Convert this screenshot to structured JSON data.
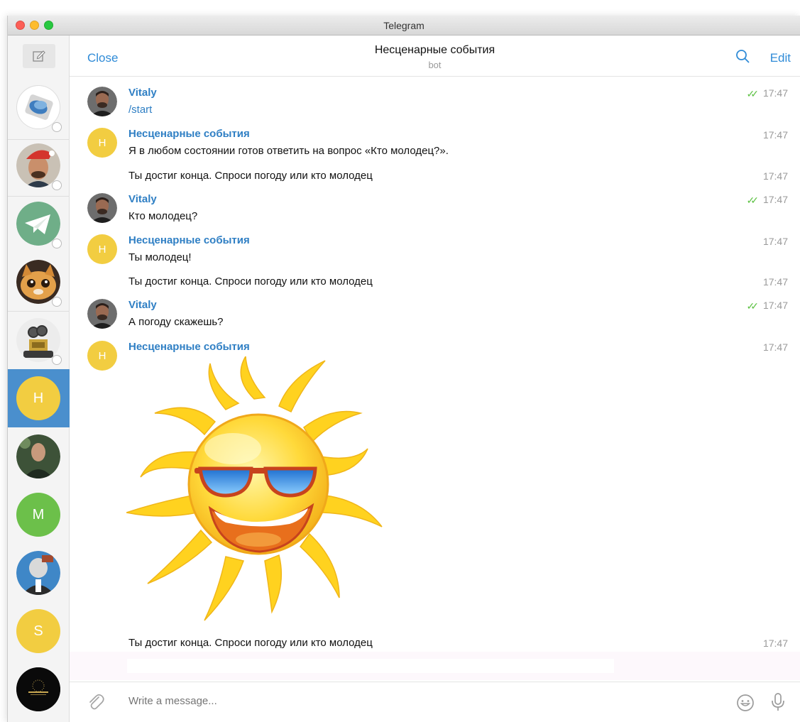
{
  "window": {
    "title": "Telegram"
  },
  "sidebar": {
    "chats": [
      {
        "name": "chat-1",
        "letter": ""
      },
      {
        "name": "chat-2",
        "letter": ""
      },
      {
        "name": "chat-telegram",
        "letter": ""
      },
      {
        "name": "chat-cat",
        "letter": ""
      },
      {
        "name": "chat-robot",
        "letter": ""
      },
      {
        "name": "chat-active",
        "letter": "Н"
      },
      {
        "name": "chat-7",
        "letter": ""
      },
      {
        "name": "chat-m",
        "letter": "M"
      },
      {
        "name": "chat-9",
        "letter": ""
      },
      {
        "name": "chat-s",
        "letter": "S"
      },
      {
        "name": "chat-11",
        "letter": ""
      }
    ]
  },
  "header": {
    "close_label": "Close",
    "title": "Несценарные события",
    "subtitle": "bot",
    "edit_label": "Edit"
  },
  "messages": [
    {
      "sender": "Vitaly",
      "text": "/start",
      "time": "17:47",
      "read": true
    },
    {
      "sender": "Несценарные события",
      "avatar_letter": "Н",
      "text": "Я в любом состоянии готов ответить на вопрос «Кто молодец?».",
      "time": "17:47"
    },
    {
      "text": "Ты достиг конца. Спроси погоду или кто молодец",
      "time": "17:47"
    },
    {
      "sender": "Vitaly",
      "text": "Кто молодец?",
      "time": "17:47",
      "read": true
    },
    {
      "sender": "Несценарные события",
      "avatar_letter": "Н",
      "text": "Ты молодец!",
      "time": "17:47"
    },
    {
      "text": "Ты достиг конца. Спроси погоду или кто молодец",
      "time": "17:47"
    },
    {
      "sender": "Vitaly",
      "text": "А погоду скажешь?",
      "time": "17:47",
      "read": true
    },
    {
      "sender": "Несценарные события",
      "avatar_letter": "Н",
      "time": "17:47"
    },
    {
      "text": "Ты достиг конца. Спроси погоду или кто молодец",
      "time": "17:47"
    }
  ],
  "composer": {
    "placeholder": "Write a message..."
  },
  "colors": {
    "accent": "#2f8bd7",
    "active_chat": "#4a8fcd",
    "bot_avatar": "#f2cd41",
    "read_check": "#5ec245"
  }
}
